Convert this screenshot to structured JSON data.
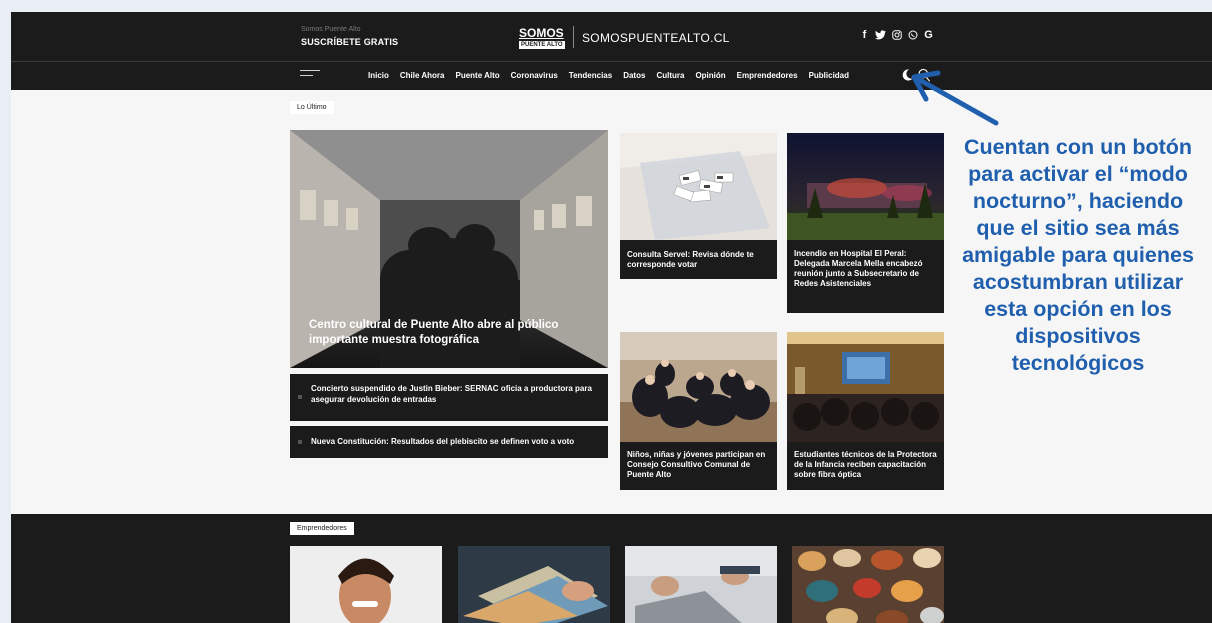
{
  "topbar": {
    "subscribe_small": "Somos Puente Alto",
    "subscribe_big": "SUSCRÍBETE GRATIS",
    "logo_main": "SOMOS",
    "logo_sub": "PUENTE ALTO",
    "site_name": "SOMOSPUENTEALTO.CL",
    "socials": [
      "f",
      "♥",
      "◎",
      "✆",
      "G"
    ]
  },
  "nav": {
    "items": [
      "Inicio",
      "Chile Ahora",
      "Puente Alto",
      "Coronavirus",
      "Tendencias",
      "Datos",
      "Cultura",
      "Opinión",
      "Emprendedores",
      "Publicidad"
    ]
  },
  "latest": {
    "label": "Lo Último",
    "main_caption": "Centro cultural de Puente Alto abre al público importante muestra fotográfica",
    "news": [
      "Concierto suspendido de Justin Bieber: SERNAC oficia a productora para asegurar devolución de entradas",
      "Nueva Constitución: Resultados del plebiscito se definen voto a voto"
    ],
    "cards": [
      "Consulta Servel: Revisa dónde te corresponde votar",
      "Incendio en Hospital El Peral: Delegada Marcela Mella encabezó reunión junto a Subsecretario de Redes Asistenciales",
      "Niños, niñas y jóvenes participan en Consejo Consultivo Comunal de Puente Alto",
      "Estudiantes técnicos de la Protectora de la Infancia reciben capacitación sobre fibra óptica"
    ]
  },
  "emprendedores": {
    "label": "Emprendedores"
  },
  "annotation": {
    "text": "Cuentan con un botón para activar el “modo nocturno”, haciendo que el sitio sea más amigable para quienes acostumbran utilizar esta opción en los dispositivos tecnológicos"
  },
  "colors": {
    "annotation": "#1f5fae",
    "dark": "#1b1b1b"
  }
}
